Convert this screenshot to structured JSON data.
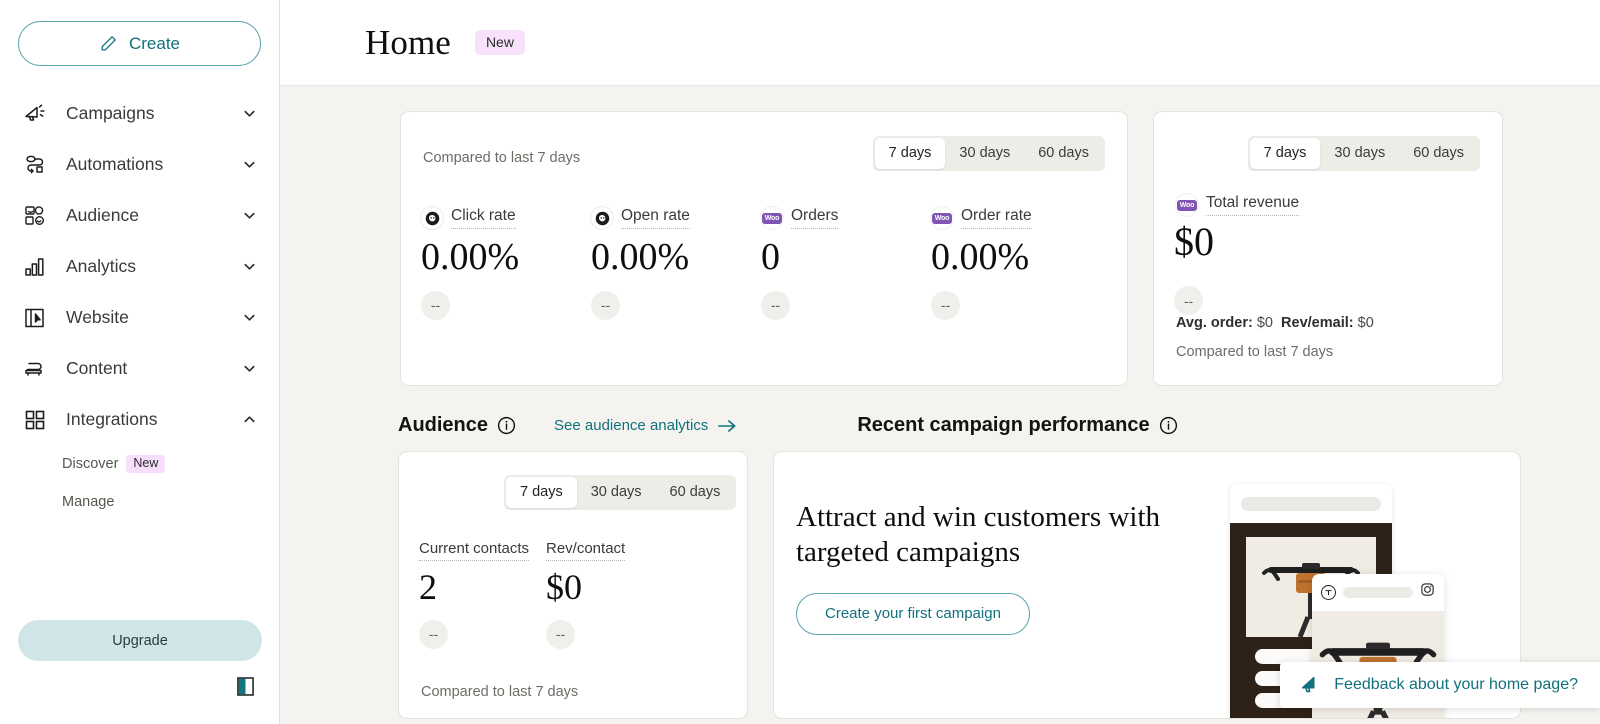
{
  "sidebar": {
    "create_label": "Create",
    "create_icon": "pencil-icon",
    "nav": [
      {
        "label": "Campaigns",
        "icon": "megaphone-icon",
        "chevron": "chevron-down-icon"
      },
      {
        "label": "Automations",
        "icon": "automation-flow-icon",
        "chevron": "chevron-down-icon"
      },
      {
        "label": "Audience",
        "icon": "people-icon",
        "chevron": "chevron-down-icon"
      },
      {
        "label": "Analytics",
        "icon": "bar-chart-icon",
        "chevron": "chevron-down-icon"
      },
      {
        "label": "Website",
        "icon": "window-cursor-icon",
        "chevron": "chevron-down-icon"
      },
      {
        "label": "Content",
        "icon": "content-stack-icon",
        "chevron": "chevron-down-icon"
      },
      {
        "label": "Integrations",
        "icon": "grid-squares-icon",
        "chevron": "chevron-up-icon"
      }
    ],
    "sub_items": [
      {
        "label": "Discover",
        "badge": "New"
      },
      {
        "label": "Manage",
        "badge": ""
      }
    ],
    "upgrade_label": "Upgrade",
    "collapse_icon": "panel-collapse-icon"
  },
  "topbar": {
    "title": "Home",
    "badge": "New"
  },
  "stats_card": {
    "compared_label": "Compared to last 7 days",
    "range_options": [
      "7 days",
      "30 days",
      "60 days"
    ],
    "range_selected": "7 days",
    "metrics": [
      {
        "label": "Click rate",
        "value": "0.00%",
        "delta": "--",
        "icon": "mailchimp-icon"
      },
      {
        "label": "Open rate",
        "value": "0.00%",
        "delta": "--",
        "icon": "mailchimp-icon"
      },
      {
        "label": "Orders",
        "value": "0",
        "delta": "--",
        "icon": "woocommerce-icon"
      },
      {
        "label": "Order rate",
        "value": "0.00%",
        "delta": "--",
        "icon": "woocommerce-icon"
      }
    ]
  },
  "revenue_card": {
    "range_options": [
      "7 days",
      "30 days",
      "60 days"
    ],
    "range_selected": "7 days",
    "icon": "woocommerce-icon",
    "label": "Total revenue",
    "value": "$0",
    "delta": "--",
    "avg_order_label": "Avg. order:",
    "avg_order_value": "$0",
    "rev_email_label": "Rev/email:",
    "rev_email_value": "$0",
    "compared_label": "Compared to last 7 days"
  },
  "audience_section": {
    "title": "Audience",
    "info_icon": "info-icon",
    "link_label": "See audience analytics",
    "link_icon": "arrow-right-icon",
    "range_options": [
      "7 days",
      "30 days",
      "60 days"
    ],
    "range_selected": "7 days",
    "metrics": [
      {
        "label": "Current contacts",
        "value": "2",
        "delta": "--"
      },
      {
        "label": "Rev/contact",
        "value": "$0",
        "delta": "--"
      }
    ],
    "compared_label": "Compared to last 7 days"
  },
  "campaign_section": {
    "title": "Recent campaign performance",
    "info_icon": "info-icon",
    "headline": "Attract and win customers with targeted campaigns",
    "cta_label": "Create your first campaign",
    "illustration": {
      "email_mock": "email-preview-mock",
      "social_mock": "instagram-post-mock",
      "social_icon": "instagram-icon",
      "avatar_icon": "avatar-icon",
      "photo": "bicycle-handlebar-bag-photo"
    }
  },
  "feedback_banner": {
    "label": "Feedback about your home page?",
    "icon": "megaphone-icon"
  },
  "colors": {
    "accent_teal": "#11717c",
    "border_teal": "#5aa5ad",
    "upgrade_bg": "#cfe5e7",
    "badge_pink": "#f6dffa",
    "page_bg": "#f4f3ef",
    "card_bg": "#ffffff",
    "woo_purple": "#7f54b3",
    "segment_bg": "#eeece7"
  }
}
